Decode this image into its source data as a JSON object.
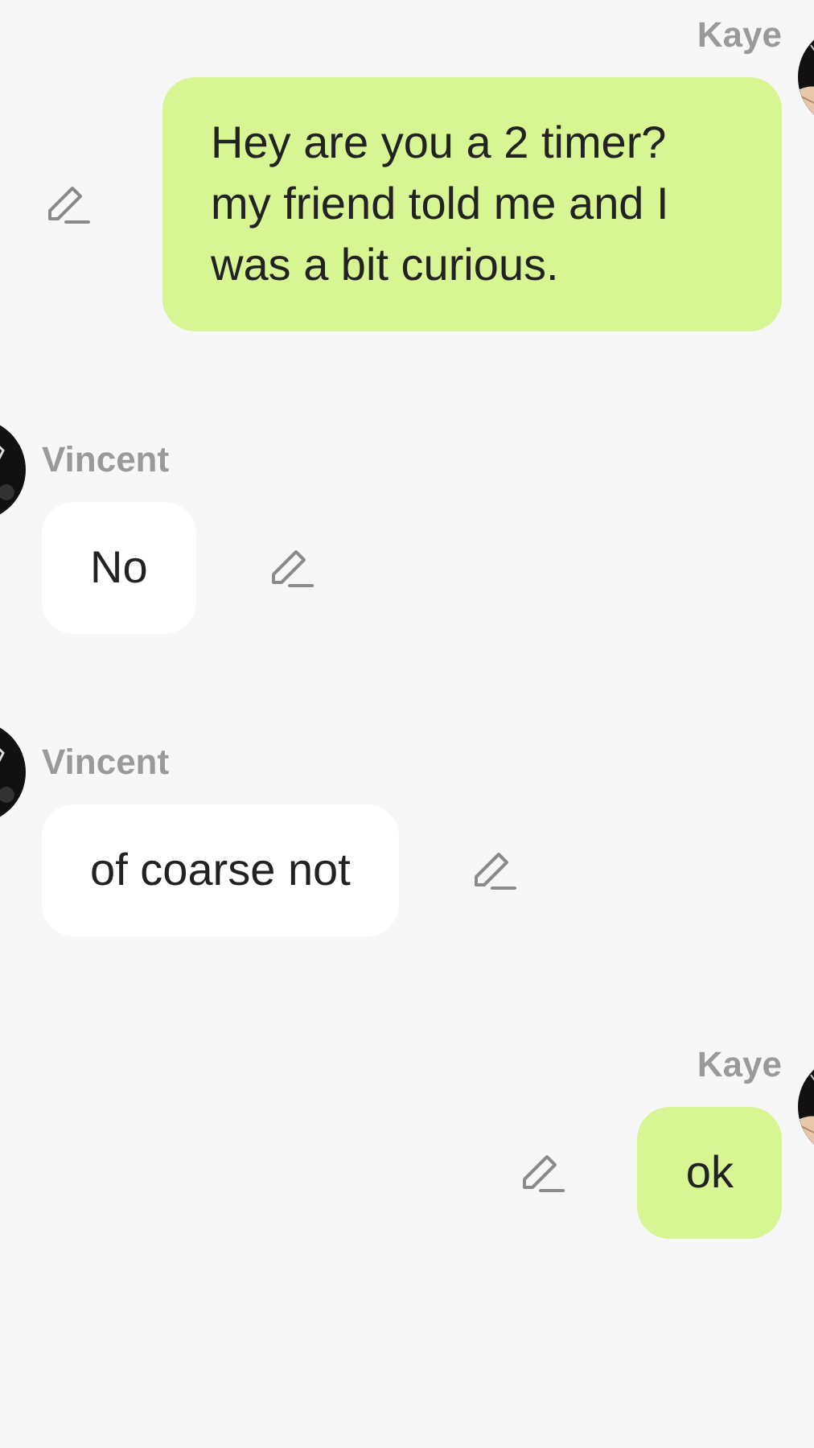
{
  "messages": [
    {
      "kind": "outgoing",
      "sender": "Kaye",
      "text": "Hey are you a 2 timer? my friend told me and I was a bit curious."
    },
    {
      "kind": "incoming",
      "sender": "Vincent",
      "text": "No"
    },
    {
      "kind": "incoming",
      "sender": "Vincent",
      "text": "of coarse not"
    },
    {
      "kind": "outgoing",
      "sender": "Kaye",
      "text": "ok"
    }
  ]
}
